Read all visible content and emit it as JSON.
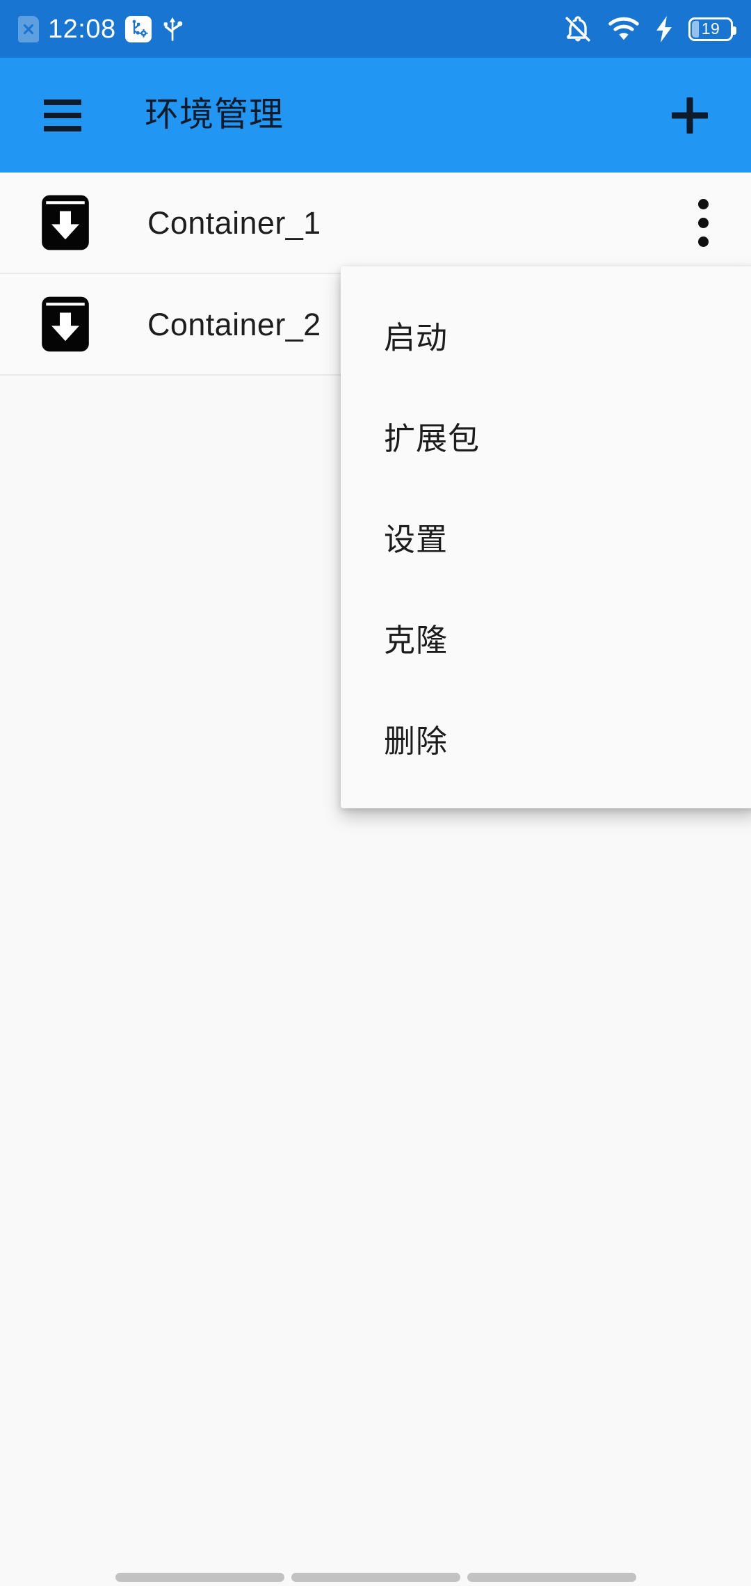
{
  "status_bar": {
    "time": "12:08",
    "battery_level": "19",
    "background_color": "#1975d2",
    "icons": {
      "sim_card_off": "sim-card-x-icon",
      "usb_debug": "usb-debug-icon",
      "usb": "usb-icon",
      "notifications_off": "bell-muted-icon",
      "wifi": "wifi-icon",
      "charging": "charging-bolt-icon",
      "battery": "battery-icon"
    }
  },
  "app_bar": {
    "title": "环境管理",
    "background_color": "#2196f3",
    "menu_icon": "hamburger-menu-icon",
    "add_icon": "plus-icon"
  },
  "list": {
    "rows": [
      {
        "label": "Container_1",
        "icon": "download-box-icon",
        "overflow_icon": "more-vertical-icon"
      },
      {
        "label": "Container_2",
        "icon": "download-box-icon",
        "overflow_icon": "more-vertical-icon"
      }
    ]
  },
  "popup_menu": {
    "items": [
      {
        "label": "启动"
      },
      {
        "label": "扩展包"
      },
      {
        "label": "设置"
      },
      {
        "label": "克隆"
      },
      {
        "label": "删除"
      }
    ]
  },
  "nav_bar": {
    "pills": [
      {
        "name": "back"
      },
      {
        "name": "home"
      },
      {
        "name": "recents"
      }
    ]
  },
  "colors": {
    "page_background": "#f9f9f9",
    "row_background": "#fafafa",
    "menu_background": "#fafafa",
    "accent_blue": "#2196f3",
    "status_blue": "#1975d2"
  }
}
